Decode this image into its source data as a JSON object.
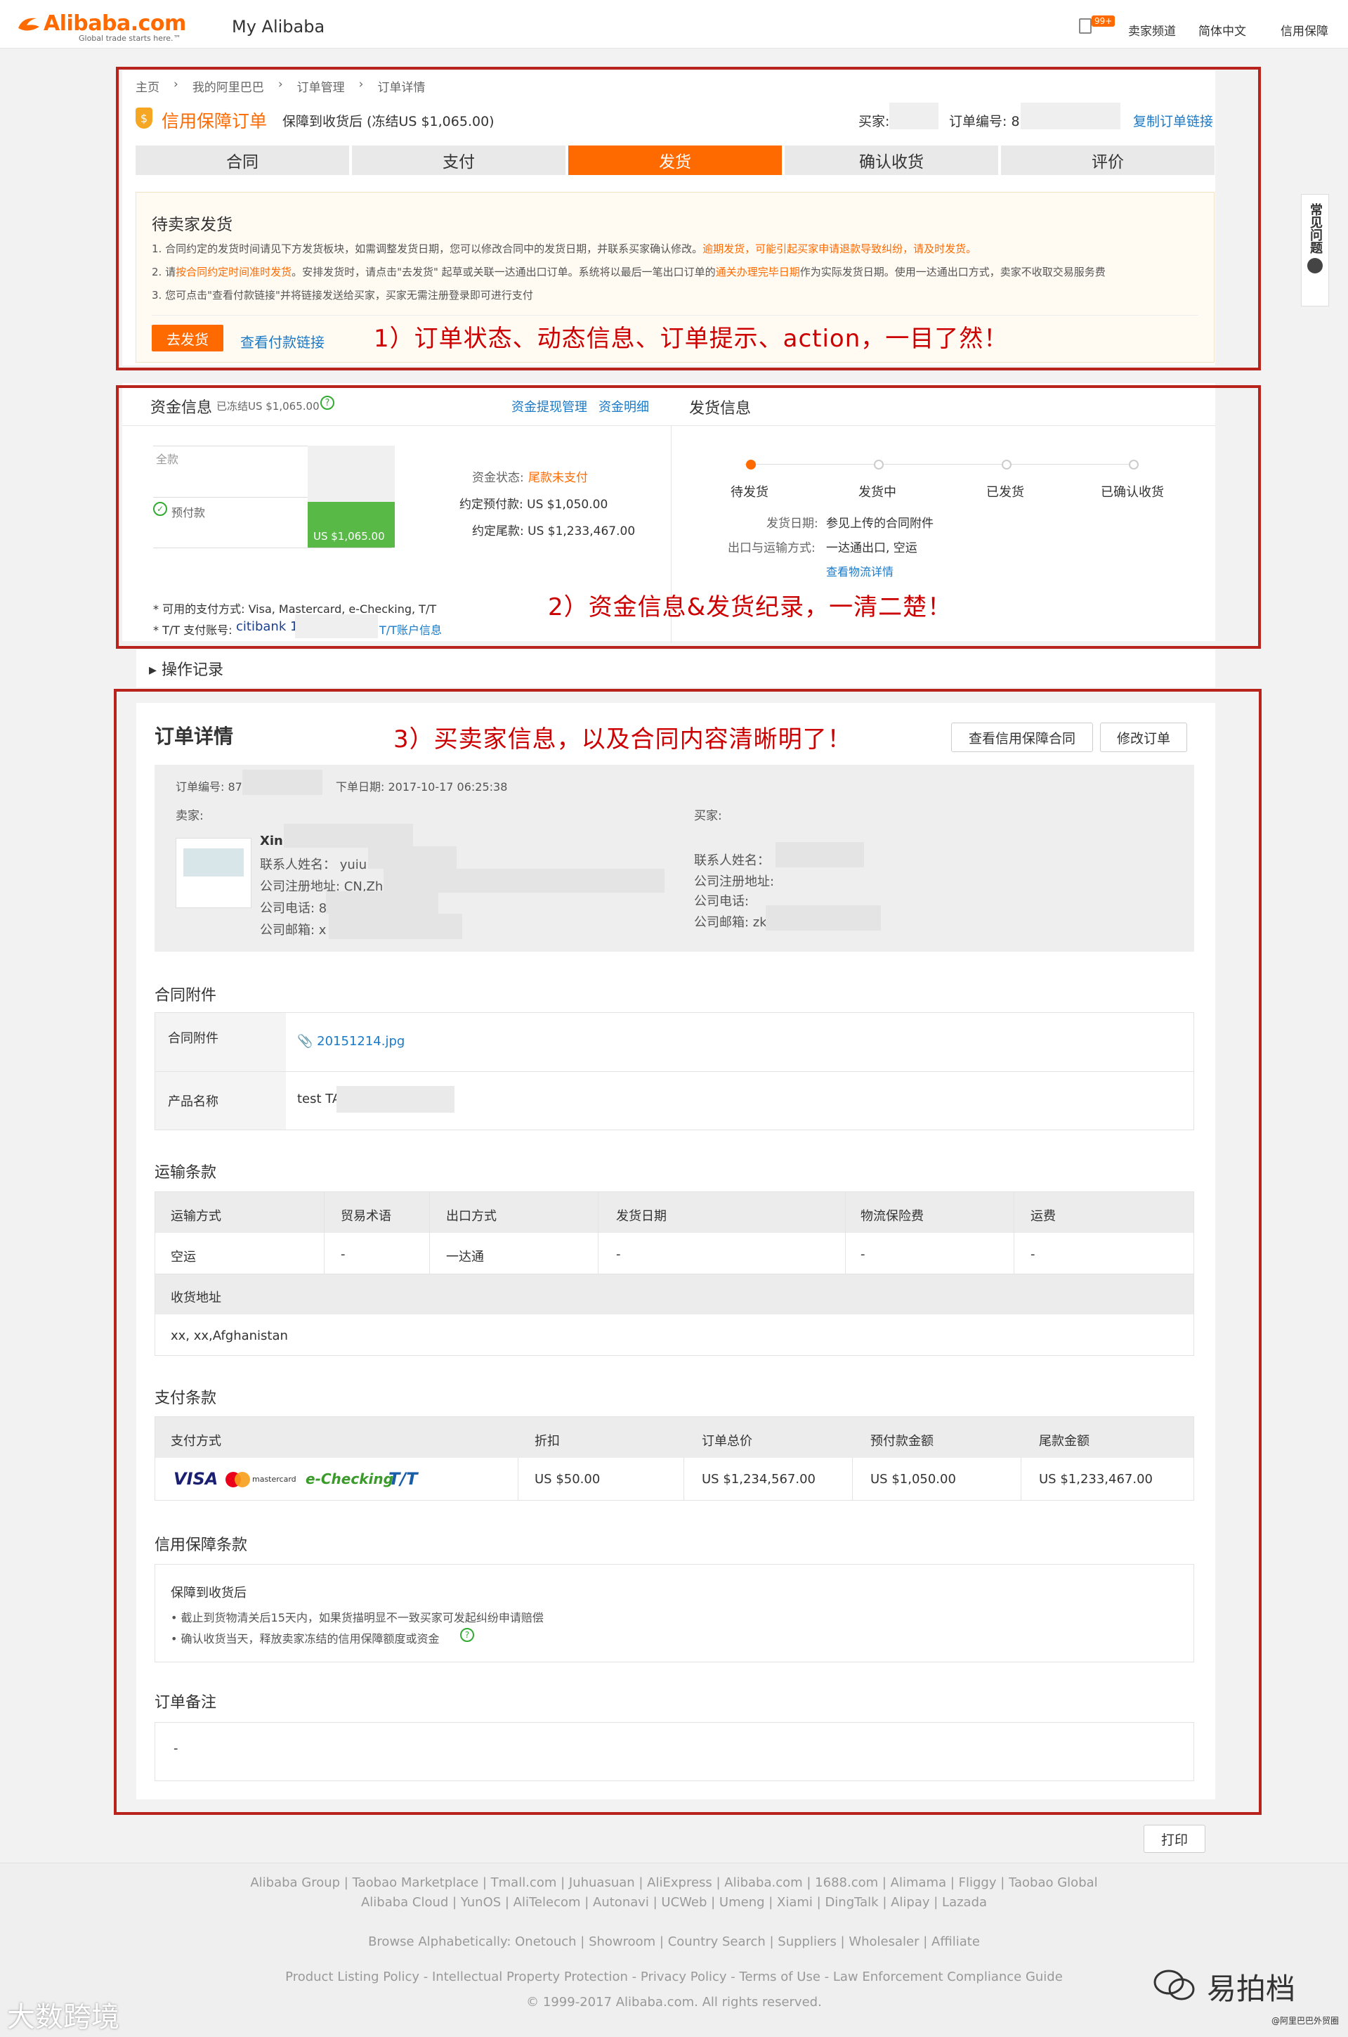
{
  "header": {
    "logo_text": "Alibaba.com",
    "logo_tagline": "Global trade starts here.™",
    "title": "My Alibaba",
    "badge": "99+",
    "nav": [
      "卖家频道",
      "简体中文",
      "信用保障"
    ]
  },
  "breadcrumb": [
    "主页",
    "我的阿里巴巴",
    "订单管理",
    "订单详情"
  ],
  "order_bar": {
    "order_type": "信用保障订单",
    "protection": "保障到收货后 (冻结US $1,065.00)",
    "buyer_label": "买家:",
    "order_no_label": "订单编号: 87",
    "copy_link": "复制订单链接"
  },
  "steps": [
    {
      "label": "合同",
      "active": false
    },
    {
      "label": "支付",
      "active": false
    },
    {
      "label": "发货",
      "active": true
    },
    {
      "label": "确认收货",
      "active": false
    },
    {
      "label": "评价",
      "active": false
    }
  ],
  "notice": {
    "title": "待卖家发货",
    "line1_a": "1. 合同约定的发货时间请见下方发货板块，如需调整发货日期，您可以修改合同中的发货日期，并联系买家确认修改。",
    "line1_b": "逾期发货，可能引起买家申请退款导致纠纷，请及时发货。",
    "line2_a": "2. 请",
    "line2_b": "按合同约定时间准时发货",
    "line2_c": "。安排发货时，请点击\"去发货\" 起草或关联一达通出口订单。系统将以最后一笔出口订单的",
    "line2_d": "通关办理完毕日期",
    "line2_e": "作为实际发货日期。使用一达通出口方式，卖家不收取交易服务费",
    "line3": "3. 您可点击\"查看付款链接\"并将链接发送给买家，买家无需注册登录即可进行支付",
    "ship_button": "去发货",
    "pay_link": "查看付款链接"
  },
  "captions": {
    "c1": "1）订单状态、动态信息、订单提示、action，一目了然！",
    "c2": "2）资金信息&发货纪录，一清二楚！",
    "c3": "3）买卖家信息，以及合同内容清晰明了！"
  },
  "funds": {
    "title": "资金信息",
    "frozen": "已冻结US $1,065.00",
    "manage_link": "资金提现管理",
    "detail_link": "资金明细",
    "full_label": "全款",
    "prepay_label": "预付款",
    "bar_value": "US $1,065.00",
    "prepay_fraction": 0.45,
    "status_label": "资金状态:",
    "status_value": "尾款未支付",
    "prepay_amount": "约定预付款: US $1,050.00",
    "balance_amount": "约定尾款: US $1,233,467.00",
    "methods": "* 可用的支付方式: Visa, Mastercard, e-Checking, T/T",
    "tt_label": "* T/T 支付账号:",
    "bank": "citibank 10",
    "tt_link": "T/T账户信息"
  },
  "shipping": {
    "title": "发货信息",
    "steps": [
      {
        "label": "待发货",
        "done": true
      },
      {
        "label": "发货中",
        "done": false
      },
      {
        "label": "已发货",
        "done": false
      },
      {
        "label": "已确认收货",
        "done": false
      }
    ],
    "date_label": "发货日期:",
    "date_value": "参见上传的合同附件",
    "method_label": "出口与运输方式:",
    "method_value": "一达通出口, 空运",
    "logistics_link": "查看物流详情"
  },
  "op_log": "操作记录",
  "detail": {
    "title": "订单详情",
    "view_contract_btn": "查看信用保障合同",
    "modify_btn": "修改订单",
    "order_no": "订单编号: 87",
    "order_date": "下单日期: 2017-10-17 06:25:38",
    "seller": {
      "label": "卖家:",
      "name": "XinE",
      "contact": "联系人姓名： yuiu",
      "address": "公司注册地址: CN,Zh",
      "phone": "公司电话: 86",
      "email": "公司邮箱: x"
    },
    "buyer": {
      "label": "买家:",
      "contact": "联系人姓名：",
      "address": "公司注册地址:",
      "phone": "公司电话:",
      "email": "公司邮箱: zk"
    }
  },
  "attachments": {
    "title": "合同附件",
    "attach_label": "合同附件",
    "attach_file": "20151214.jpg",
    "product_label": "产品名称",
    "product_value": "test TA"
  },
  "transport": {
    "title": "运输条款",
    "headers": [
      "运输方式",
      "贸易术语",
      "出口方式",
      "发货日期",
      "物流保险费",
      "运费"
    ],
    "row": [
      "空运",
      "-",
      "一达通",
      "-",
      "-",
      "-"
    ],
    "address_label": "收货地址",
    "address_value": "xx, xx,Afghanistan"
  },
  "payment": {
    "title": "支付条款",
    "headers": [
      "支付方式",
      "折扣",
      "订单总价",
      "预付款金额",
      "尾款金额"
    ],
    "methods": [
      "VISA",
      "mastercard",
      "e-Checking",
      "T/T"
    ],
    "row": [
      "US $50.00",
      "US $1,234,567.00",
      "US $1,050.00",
      "US $1,233,467.00"
    ]
  },
  "guarantee": {
    "title": "信用保障条款",
    "sub": "保障到收货后",
    "item1": "截止到货物清关后15天内，如果货描明显不一致买家可发起纠纷申请赔偿",
    "item2": "确认收货当天，释放卖家冻结的信用保障额度或资金"
  },
  "remark": {
    "title": "订单备注",
    "value": "-"
  },
  "print_btn": "打印",
  "side_help": "常见问题",
  "footer": {
    "line1": "Alibaba Group | Taobao Marketplace | Tmall.com | Juhuasuan | AliExpress | Alibaba.com | 1688.com | Alimama | Fliggy | Taobao Global",
    "line2": "Alibaba Cloud | YunOS | AliTelecom | Autonavi | UCWeb | Umeng | Xiami | DingTalk | Alipay | Lazada",
    "line3": "Browse Alphabetically: Onetouch | Showroom | Country Search | Suppliers | Wholesaler | Affiliate",
    "line4": "Product Listing Policy - Intellectual Property Protection - Privacy Policy - Terms of Use - Law Enforcement Compliance Guide",
    "line5": "© 1999-2017 Alibaba.com. All rights reserved.",
    "wm_left": "大数跨境",
    "wm_right": "易拍档",
    "wm_small": "@阿里巴巴外贸圈"
  }
}
